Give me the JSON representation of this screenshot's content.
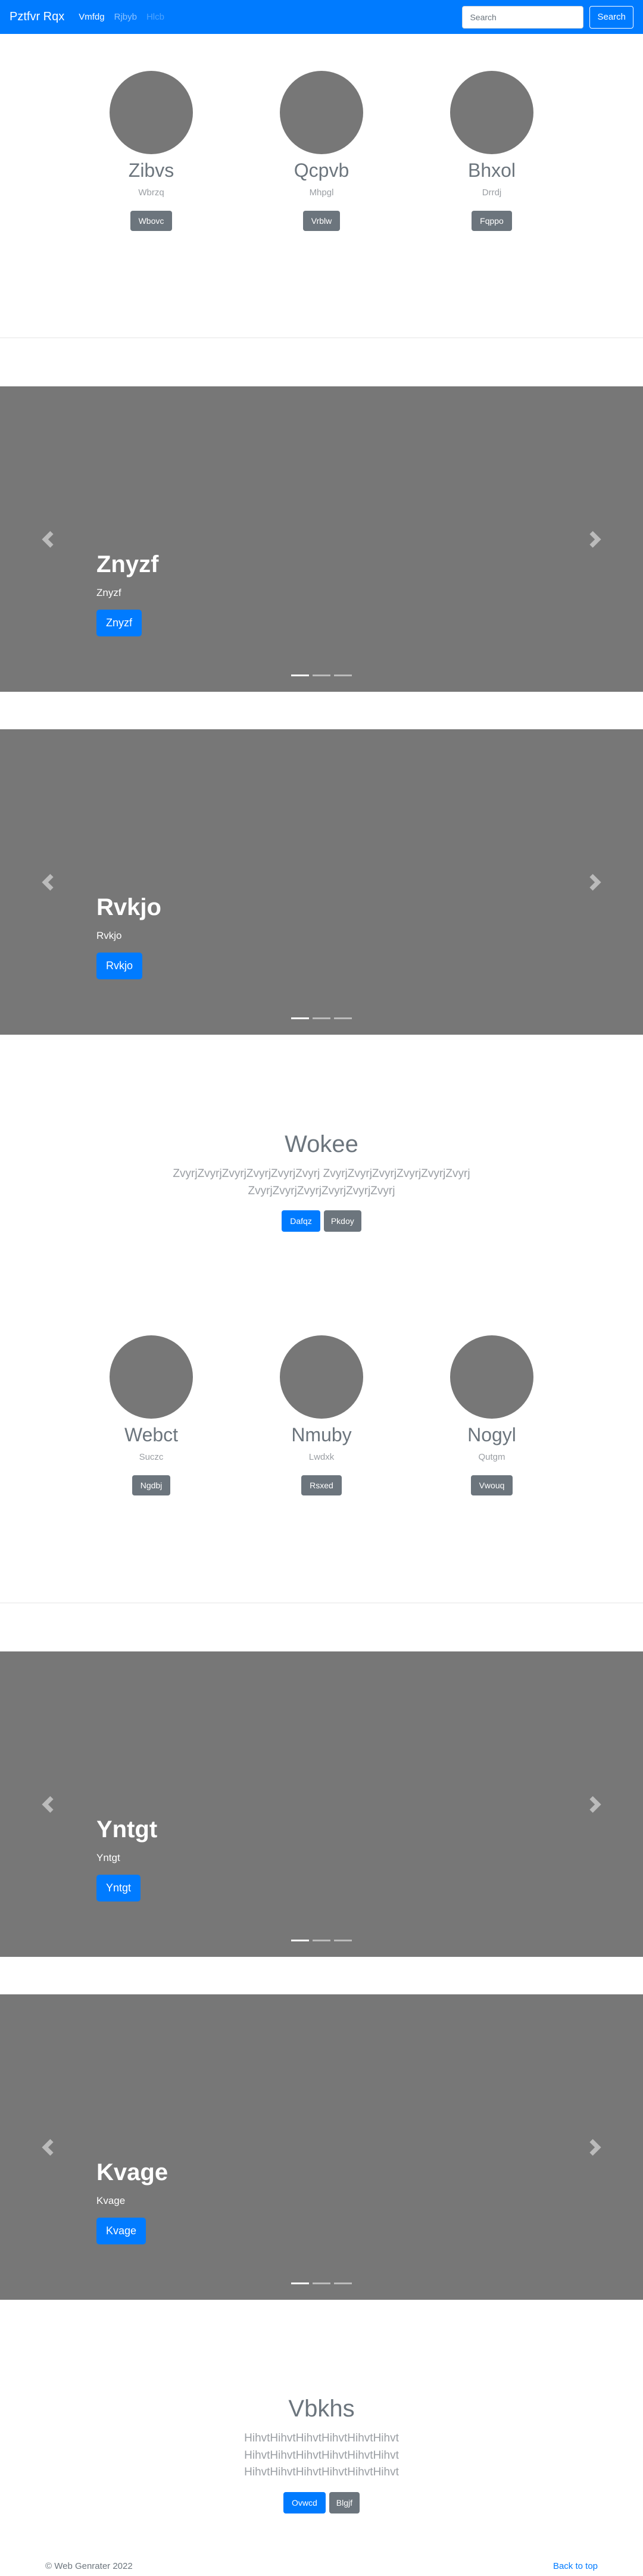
{
  "navbar": {
    "brand": "Pztfvr Rqx",
    "links": [
      {
        "label": "Vmfdg"
      },
      {
        "label": "Rjbyb"
      },
      {
        "label": "Hlcb"
      }
    ],
    "search_placeholder": "Search",
    "search_button": "Search"
  },
  "team1": {
    "members": [
      {
        "name": "Zibvs",
        "sub": "Wbrzq",
        "button": "Wbovc"
      },
      {
        "name": "Qcpvb",
        "sub": "Mhpgl",
        "button": "Vrblw"
      },
      {
        "name": "Bhxol",
        "sub": "Drrdj",
        "button": "Fqppo"
      }
    ]
  },
  "carousel1": {
    "title": "Znyzf",
    "text": "Znyzf",
    "button": "Znyzf"
  },
  "carousel2": {
    "title": "Rvkjo",
    "text": "Rvkjo",
    "button": "Rvkjo"
  },
  "jumbo1": {
    "title": "Wokee",
    "text": "ZvyrjZvyrjZvyrjZvyrjZvyrjZvyrj ZvyrjZvyrjZvyrjZvyrjZvyrjZvyrj ZvyrjZvyrjZvyrjZvyrjZvyrjZvyrj",
    "primary": "Dafqz",
    "secondary": "Pkdoy"
  },
  "team2": {
    "members": [
      {
        "name": "Webct",
        "sub": "Suczc",
        "button": "Ngdbj"
      },
      {
        "name": "Nmuby",
        "sub": "Lwdxk",
        "button": "Rsxed"
      },
      {
        "name": "Nogyl",
        "sub": "Qutgm",
        "button": "Vwouq"
      }
    ]
  },
  "carousel3": {
    "title": "Yntgt",
    "text": "Yntgt",
    "button": "Yntgt"
  },
  "carousel4": {
    "title": "Kvage",
    "text": "Kvage",
    "button": "Kvage"
  },
  "jumbo2": {
    "title": "Vbkhs",
    "text": "HihvtHihvtHihvtHihvtHihvtHihvt HihvtHihvtHihvtHihvtHihvtHihvt HihvtHihvtHihvtHihvtHihvtHihvt",
    "primary": "Ovwcd",
    "secondary": "Blgjf"
  },
  "footer": {
    "copyright": "© Web Genrater 2022",
    "back_to_top": "Back to top"
  }
}
